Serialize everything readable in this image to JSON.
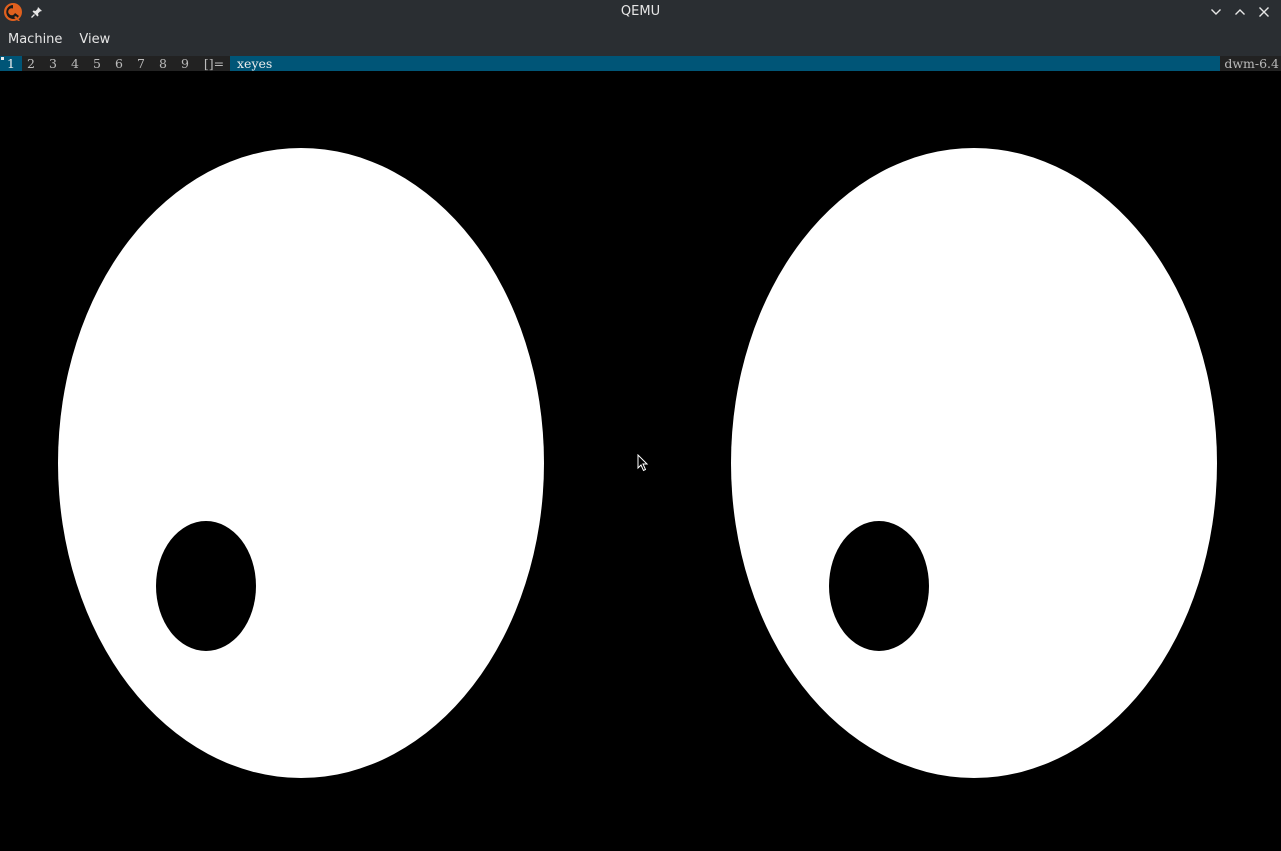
{
  "window": {
    "title": "QEMU"
  },
  "menubar": {
    "items": [
      {
        "label": "Machine"
      },
      {
        "label": "View"
      }
    ]
  },
  "dwm": {
    "tags": [
      "1",
      "2",
      "3",
      "4",
      "5",
      "6",
      "7",
      "8",
      "9"
    ],
    "selected_tag": "1",
    "layout_symbol": "[]=",
    "client_title": "xeyes",
    "status": "dwm-6.4",
    "colors": {
      "bar_bg": "#222222",
      "selected_bg": "#005577",
      "normal_fg": "#bbbbbb",
      "selected_fg": "#eeeeee"
    }
  },
  "xeyes": {
    "background": "#000000",
    "eye_color": "#ffffff",
    "pupil_color": "#000000"
  },
  "icons": {
    "app_logo": "qemu-logo-icon",
    "pin": "pin-icon",
    "minimize": "chevron-down-icon",
    "maximize": "chevron-up-icon",
    "close": "close-icon",
    "cursor": "mouse-pointer-icon"
  }
}
